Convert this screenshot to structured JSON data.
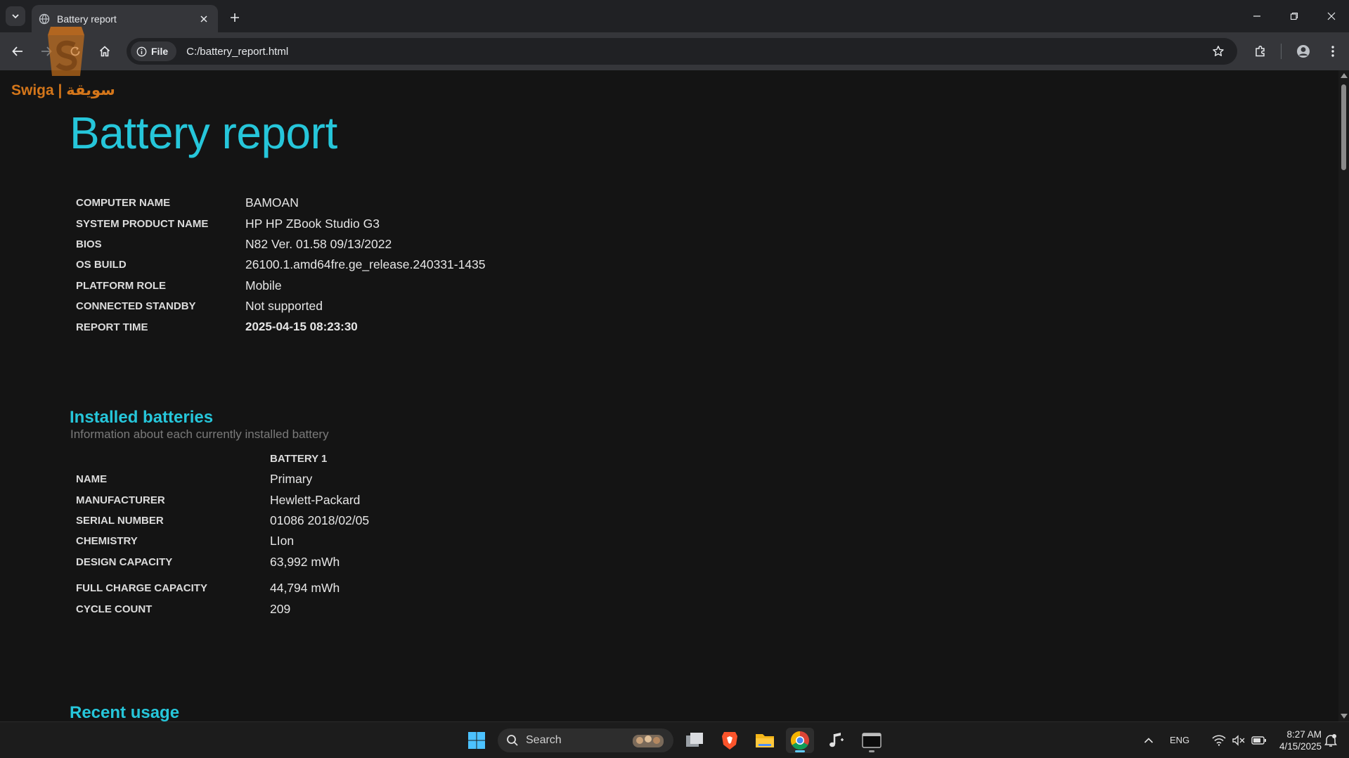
{
  "browser": {
    "tab_title": "Battery report",
    "address_chip": "File",
    "url": "C:/battery_report.html"
  },
  "watermark": {
    "text": "Swiga | سويقة"
  },
  "report": {
    "title": "Battery report",
    "system_info": [
      {
        "key": "COMPUTER NAME",
        "value": "BAMOAN"
      },
      {
        "key": "SYSTEM PRODUCT NAME",
        "value": "HP HP ZBook Studio G3"
      },
      {
        "key": "BIOS",
        "value": "N82 Ver. 01.58 09/13/2022"
      },
      {
        "key": "OS BUILD",
        "value": "26100.1.amd64fre.ge_release.240331-1435"
      },
      {
        "key": "PLATFORM ROLE",
        "value": "Mobile"
      },
      {
        "key": "CONNECTED STANDBY",
        "value": "Not supported"
      },
      {
        "key": "REPORT TIME",
        "value": "2025-04-15  08:23:30"
      }
    ],
    "installed_batteries": {
      "heading": "Installed batteries",
      "subheading": "Information about each currently installed battery",
      "column_header": "BATTERY 1",
      "rows": [
        {
          "key": "NAME",
          "value": "Primary"
        },
        {
          "key": "MANUFACTURER",
          "value": "Hewlett-Packard"
        },
        {
          "key": "SERIAL NUMBER",
          "value": "01086 2018/02/05"
        },
        {
          "key": "CHEMISTRY",
          "value": "LIon"
        },
        {
          "key": "DESIGN CAPACITY",
          "value": "63,992 mWh"
        },
        {
          "key": "FULL CHARGE CAPACITY",
          "value": "44,794 mWh"
        },
        {
          "key": "CYCLE COUNT",
          "value": "209"
        }
      ]
    },
    "recent_usage_heading": "Recent usage"
  },
  "taskbar": {
    "search_label": "Search",
    "language": "ENG",
    "time": "8:27 AM",
    "date": "4/15/2025"
  },
  "colors": {
    "accent": "#26c6da",
    "background": "#141414",
    "watermark": "#d4761a"
  },
  "icons": {
    "tab_search": "chevron-down-icon",
    "tab_favicon": "globe-icon",
    "close": "close-icon",
    "new_tab": "plus-icon",
    "back": "arrow-left-icon",
    "forward": "arrow-right-icon",
    "reload": "reload-icon",
    "home": "home-icon",
    "info": "info-icon",
    "bookmark": "star-icon",
    "extensions": "puzzle-icon",
    "profile": "profile-icon",
    "menu": "kebab-menu-icon"
  }
}
